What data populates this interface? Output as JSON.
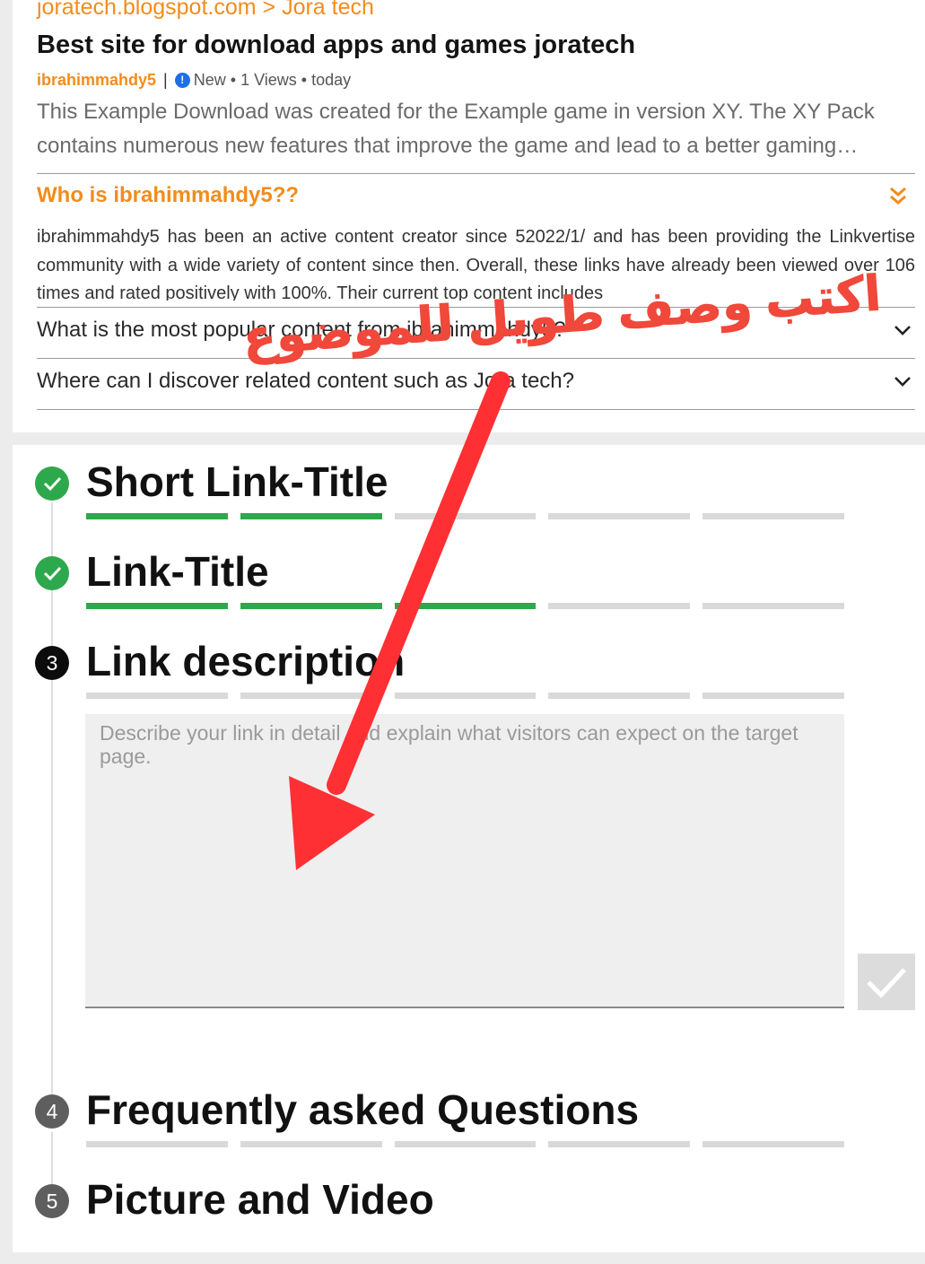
{
  "preview": {
    "breadcrumb": "joratech.blogspot.com > Jora tech",
    "title": "Best site for download apps and games joratech",
    "author": "ibrahimmahdy5",
    "separator": "|",
    "status": "New",
    "views": "1 Views",
    "time": "today",
    "description": "This Example Download was created for the Example game in version XY. The XY Pack contains numerous new features that improve the game and lead to a better gaming…"
  },
  "about": {
    "heading": "Who is ibrahimmahdy5??",
    "body": "ibrahimmahdy5 has been an active content creator since 52022/1/ and has been providing the Linkvertise community with a wide variety of content since then. Overall, these links have already been viewed over 106 times and rated positively with 100%. Their current top content includes"
  },
  "faq": [
    {
      "question": "What is the most popular content from ibrahimmahdy5?"
    },
    {
      "question": "Where can I discover related content such as Jora tech?"
    }
  ],
  "steps": [
    {
      "number": "✓",
      "title": "Short Link-Title",
      "progress": [
        1,
        1,
        0,
        0,
        0
      ]
    },
    {
      "number": "✓",
      "title": "Link-Title",
      "progress": [
        1,
        1,
        1,
        0,
        0
      ]
    },
    {
      "number": "3",
      "title": "Link description",
      "progress": [
        0,
        0,
        0,
        0,
        0
      ]
    },
    {
      "number": "4",
      "title": "Frequently asked Questions",
      "progress": [
        0,
        0,
        0,
        0,
        0
      ]
    },
    {
      "number": "5",
      "title": "Picture and Video",
      "progress": [
        0,
        0,
        0,
        0,
        0
      ]
    }
  ],
  "description_field": {
    "value": "",
    "placeholder": "Describe your link in detail and explain what visitors can expect on the target page."
  },
  "annotation": {
    "text": "اكتب وصف طويل للموضوع",
    "color": "#f0483a"
  },
  "colors": {
    "accent": "#f28c1c",
    "success": "#2ea84c",
    "annotation": "#ff2b2b"
  }
}
